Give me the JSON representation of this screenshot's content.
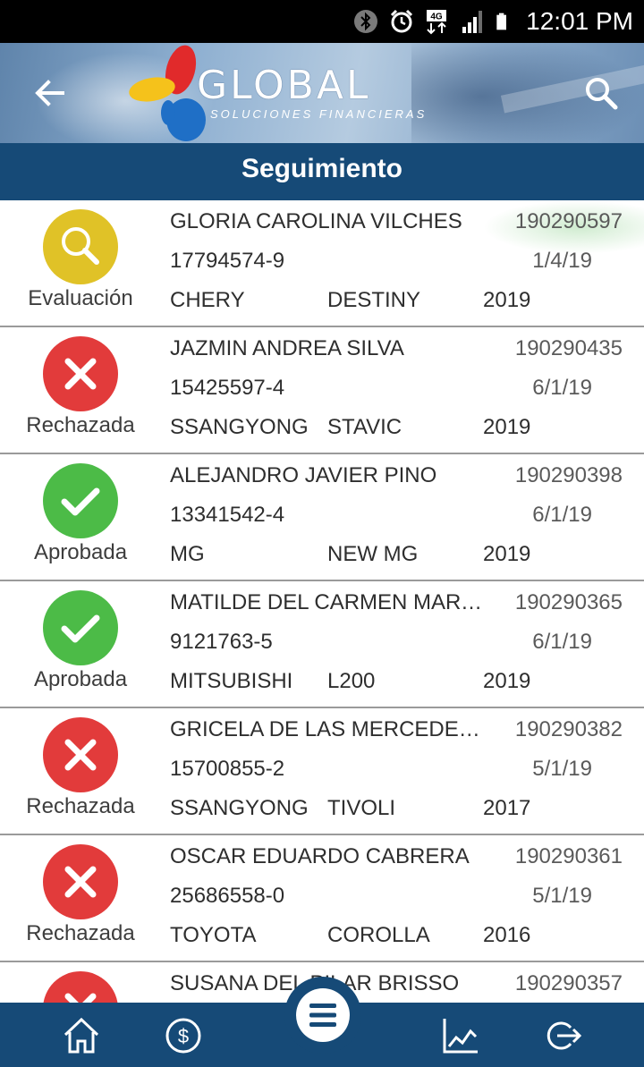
{
  "status_bar": {
    "time": "12:01 PM",
    "network": "4G",
    "icons": [
      "bluetooth-icon",
      "alarm-icon",
      "network-4g-icon",
      "signal-icon",
      "battery-icon"
    ]
  },
  "header": {
    "brand": "GLOBAL",
    "tagline": "SOLUCIONES FINANCIERAS",
    "back_icon": "arrow-left-icon",
    "search_icon": "search-icon"
  },
  "title": "Seguimiento",
  "colors": {
    "primary": "#164a77",
    "evaluacion": "#e0c227",
    "rechazada": "#e23b3b",
    "aprobada": "#4cbb47"
  },
  "applications": [
    {
      "status": "Evaluación",
      "status_key": "evaluacion",
      "name": "GLORIA CAROLINA VILCHES",
      "code": "190290597",
      "rut": "17794574-9",
      "date": "1/4/19",
      "make": "CHERY",
      "model": "DESTINY",
      "year": "2019"
    },
    {
      "status": "Rechazada",
      "status_key": "rechazada",
      "name": "JAZMIN ANDREA SILVA",
      "code": "190290435",
      "rut": "15425597-4",
      "date": "6/1/19",
      "make": "SSANGYONG",
      "model": "STAVIC",
      "year": "2019"
    },
    {
      "status": "Aprobada",
      "status_key": "aprobada",
      "name": "ALEJANDRO JAVIER PINO",
      "code": "190290398",
      "rut": "13341542-4",
      "date": "6/1/19",
      "make": "MG",
      "model": "NEW MG",
      "year": "2019"
    },
    {
      "status": "Aprobada",
      "status_key": "aprobada",
      "name": "MATILDE DEL CARMEN MARTÍNEZ",
      "code": "190290365",
      "rut": "9121763-5",
      "date": "6/1/19",
      "make": "MITSUBISHI",
      "model": "L200",
      "year": "2019"
    },
    {
      "status": "Rechazada",
      "status_key": "rechazada",
      "name": "GRICELA DE LAS MERCEDES ROJAS",
      "code": "190290382",
      "rut": "15700855-2",
      "date": "5/1/19",
      "make": "SSANGYONG",
      "model": "TIVOLI",
      "year": "2017"
    },
    {
      "status": "Rechazada",
      "status_key": "rechazada",
      "name": "OSCAR EDUARDO CABRERA",
      "code": "190290361",
      "rut": "25686558-0",
      "date": "5/1/19",
      "make": "TOYOTA",
      "model": "COROLLA",
      "year": "2016"
    },
    {
      "status": "Rechazada",
      "status_key": "rechazada",
      "name": "SUSANA DEL PILAR BRISSO",
      "code": "190290357",
      "rut": "",
      "date": "",
      "make": "",
      "model": "",
      "year": ""
    }
  ],
  "bottom_nav": {
    "items": [
      "home-icon",
      "dollar-icon",
      "menu-icon",
      "chart-icon",
      "logout-icon"
    ]
  }
}
